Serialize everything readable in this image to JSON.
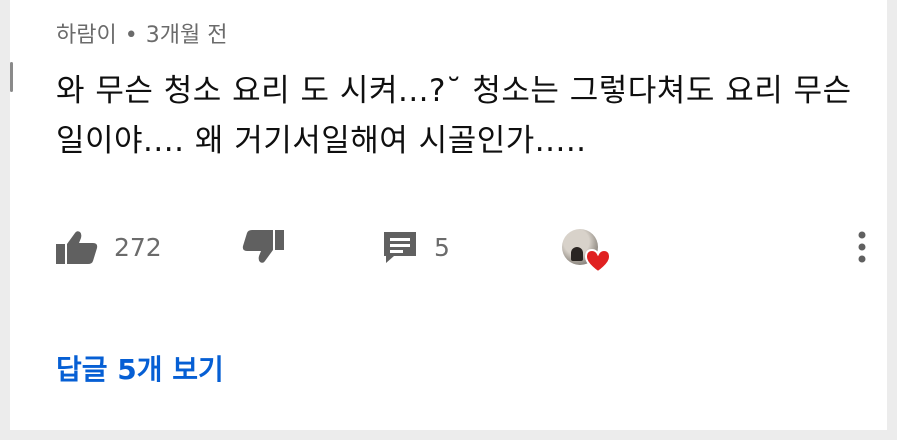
{
  "comment": {
    "author": "하람이",
    "separator": "•",
    "time": "3개월 전",
    "text": "와 무슨 청소 요리 도 시켜...?˘ 청소는 그렇다쳐도 요리 무슨일이야.... 왜 거기서일해여 시골인가.....",
    "likes": "272",
    "replies_count": "5",
    "view_replies_label": "답글 5개 보기"
  },
  "icons": {
    "like": "thumbs-up-icon",
    "dislike": "thumbs-down-icon",
    "reply": "comment-icon",
    "creator_heart": "heart-icon",
    "menu": "more-vertical-icon"
  },
  "colors": {
    "text": "#0f0f0f",
    "secondary_text": "#6b6b6b",
    "link": "#065fd4",
    "heart": "#e02121",
    "background": "#ffffff"
  }
}
